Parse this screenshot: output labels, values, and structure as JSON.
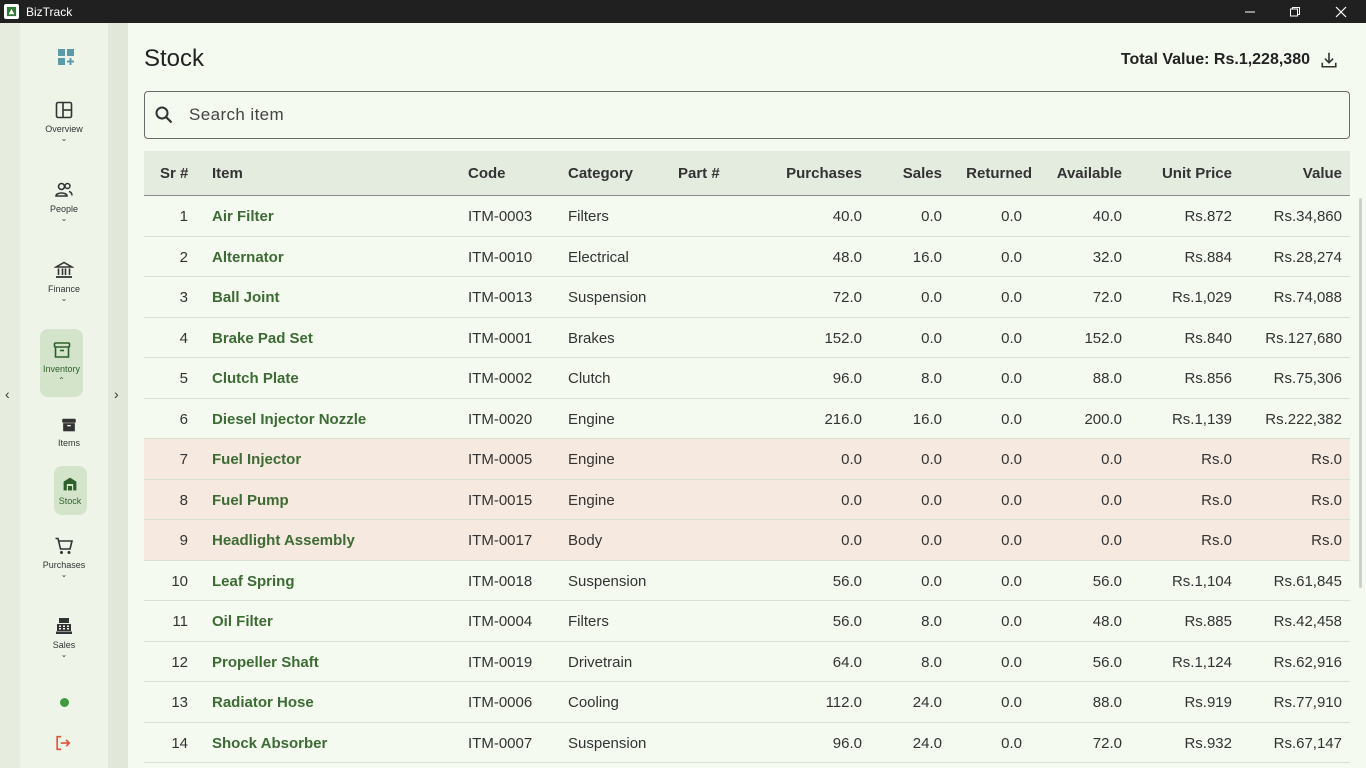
{
  "window": {
    "title": "BizTrack"
  },
  "nav": {
    "overview": "Overview",
    "people": "People",
    "finance": "Finance",
    "inventory": "Inventory",
    "items": "Items",
    "stock": "Stock",
    "purchases": "Purchases",
    "sales": "Sales"
  },
  "page": {
    "title": "Stock",
    "total_value": "Total Value: Rs.1,228,380"
  },
  "search": {
    "placeholder": "Search item"
  },
  "table": {
    "headers": [
      "Sr #",
      "Item",
      "Code",
      "Category",
      "Part #",
      "Purchases",
      "Sales",
      "Returned",
      "Available",
      "Unit Price",
      "Value"
    ],
    "rows": [
      {
        "sr": "1",
        "item": "Air Filter",
        "code": "ITM-0003",
        "category": "Filters",
        "part": "",
        "purchases": "40.0",
        "sales": "0.0",
        "returned": "0.0",
        "available": "40.0",
        "unit_price": "Rs.872",
        "value": "Rs.34,860"
      },
      {
        "sr": "2",
        "item": "Alternator",
        "code": "ITM-0010",
        "category": "Electrical",
        "part": "",
        "purchases": "48.0",
        "sales": "16.0",
        "returned": "0.0",
        "available": "32.0",
        "unit_price": "Rs.884",
        "value": "Rs.28,274"
      },
      {
        "sr": "3",
        "item": "Ball Joint",
        "code": "ITM-0013",
        "category": "Suspension",
        "part": "",
        "purchases": "72.0",
        "sales": "0.0",
        "returned": "0.0",
        "available": "72.0",
        "unit_price": "Rs.1,029",
        "value": "Rs.74,088"
      },
      {
        "sr": "4",
        "item": "Brake Pad Set",
        "code": "ITM-0001",
        "category": "Brakes",
        "part": "",
        "purchases": "152.0",
        "sales": "0.0",
        "returned": "0.0",
        "available": "152.0",
        "unit_price": "Rs.840",
        "value": "Rs.127,680"
      },
      {
        "sr": "5",
        "item": "Clutch Plate",
        "code": "ITM-0002",
        "category": "Clutch",
        "part": "",
        "purchases": "96.0",
        "sales": "8.0",
        "returned": "0.0",
        "available": "88.0",
        "unit_price": "Rs.856",
        "value": "Rs.75,306"
      },
      {
        "sr": "6",
        "item": "Diesel Injector Nozzle",
        "code": "ITM-0020",
        "category": "Engine",
        "part": "",
        "purchases": "216.0",
        "sales": "16.0",
        "returned": "0.0",
        "available": "200.0",
        "unit_price": "Rs.1,139",
        "value": "Rs.222,382"
      },
      {
        "sr": "7",
        "item": "Fuel Injector",
        "code": "ITM-0005",
        "category": "Engine",
        "part": "",
        "purchases": "0.0",
        "sales": "0.0",
        "returned": "0.0",
        "available": "0.0",
        "unit_price": "Rs.0",
        "value": "Rs.0",
        "zero": true
      },
      {
        "sr": "8",
        "item": "Fuel Pump",
        "code": "ITM-0015",
        "category": "Engine",
        "part": "",
        "purchases": "0.0",
        "sales": "0.0",
        "returned": "0.0",
        "available": "0.0",
        "unit_price": "Rs.0",
        "value": "Rs.0",
        "zero": true
      },
      {
        "sr": "9",
        "item": "Headlight Assembly",
        "code": "ITM-0017",
        "category": "Body",
        "part": "",
        "purchases": "0.0",
        "sales": "0.0",
        "returned": "0.0",
        "available": "0.0",
        "unit_price": "Rs.0",
        "value": "Rs.0",
        "zero": true
      },
      {
        "sr": "10",
        "item": "Leaf Spring",
        "code": "ITM-0018",
        "category": "Suspension",
        "part": "",
        "purchases": "56.0",
        "sales": "0.0",
        "returned": "0.0",
        "available": "56.0",
        "unit_price": "Rs.1,104",
        "value": "Rs.61,845"
      },
      {
        "sr": "11",
        "item": "Oil Filter",
        "code": "ITM-0004",
        "category": "Filters",
        "part": "",
        "purchases": "56.0",
        "sales": "8.0",
        "returned": "0.0",
        "available": "48.0",
        "unit_price": "Rs.885",
        "value": "Rs.42,458"
      },
      {
        "sr": "12",
        "item": "Propeller Shaft",
        "code": "ITM-0019",
        "category": "Drivetrain",
        "part": "",
        "purchases": "64.0",
        "sales": "8.0",
        "returned": "0.0",
        "available": "56.0",
        "unit_price": "Rs.1,124",
        "value": "Rs.62,916"
      },
      {
        "sr": "13",
        "item": "Radiator Hose",
        "code": "ITM-0006",
        "category": "Cooling",
        "part": "",
        "purchases": "112.0",
        "sales": "24.0",
        "returned": "0.0",
        "available": "88.0",
        "unit_price": "Rs.919",
        "value": "Rs.77,910"
      },
      {
        "sr": "14",
        "item": "Shock Absorber",
        "code": "ITM-0007",
        "category": "Suspension",
        "part": "",
        "purchases": "96.0",
        "sales": "24.0",
        "returned": "0.0",
        "available": "72.0",
        "unit_price": "Rs.932",
        "value": "Rs.67,147"
      }
    ]
  },
  "colors": {
    "accent": "#3d6b34",
    "zero_row": "#f6e9df",
    "logout": "#e0533d",
    "status_dot": "#3e9b3e"
  }
}
